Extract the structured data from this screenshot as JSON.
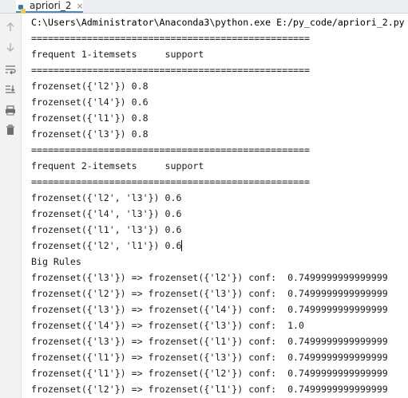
{
  "tab": {
    "title": "apriori_2",
    "icon": "python-icon",
    "close": "×"
  },
  "toolbar": {
    "icons": [
      "arrow-up-icon",
      "arrow-down-icon",
      "soft-wrap-icon",
      "scroll-to-end-icon",
      "print-icon",
      "trash-icon"
    ]
  },
  "console": {
    "lines": [
      "C:\\Users\\Administrator\\Anaconda3\\python.exe E:/py_code/apriori_2.py",
      "==================================================",
      "frequent 1-itemsets     support",
      "==================================================",
      "frozenset({'l2'}) 0.8",
      "frozenset({'l4'}) 0.6",
      "frozenset({'l1'}) 0.8",
      "frozenset({'l3'}) 0.8",
      "==================================================",
      "frequent 2-itemsets     support",
      "==================================================",
      "frozenset({'l2', 'l3'}) 0.6",
      "frozenset({'l4', 'l3'}) 0.6",
      "frozenset({'l1', 'l3'}) 0.6",
      "frozenset({'l2', 'l1'}) 0.6",
      "Big Rules",
      "frozenset({'l3'}) => frozenset({'l2'}) conf:  0.7499999999999999",
      "frozenset({'l2'}) => frozenset({'l3'}) conf:  0.7499999999999999",
      "frozenset({'l3'}) => frozenset({'l4'}) conf:  0.7499999999999999",
      "frozenset({'l4'}) => frozenset({'l3'}) conf:  1.0",
      "frozenset({'l3'}) => frozenset({'l1'}) conf:  0.7499999999999999",
      "frozenset({'l1'}) => frozenset({'l3'}) conf:  0.7499999999999999",
      "frozenset({'l1'}) => frozenset({'l2'}) conf:  0.7499999999999999",
      "frozenset({'l2'}) => frozenset({'l1'}) conf:  0.7499999999999999"
    ]
  }
}
